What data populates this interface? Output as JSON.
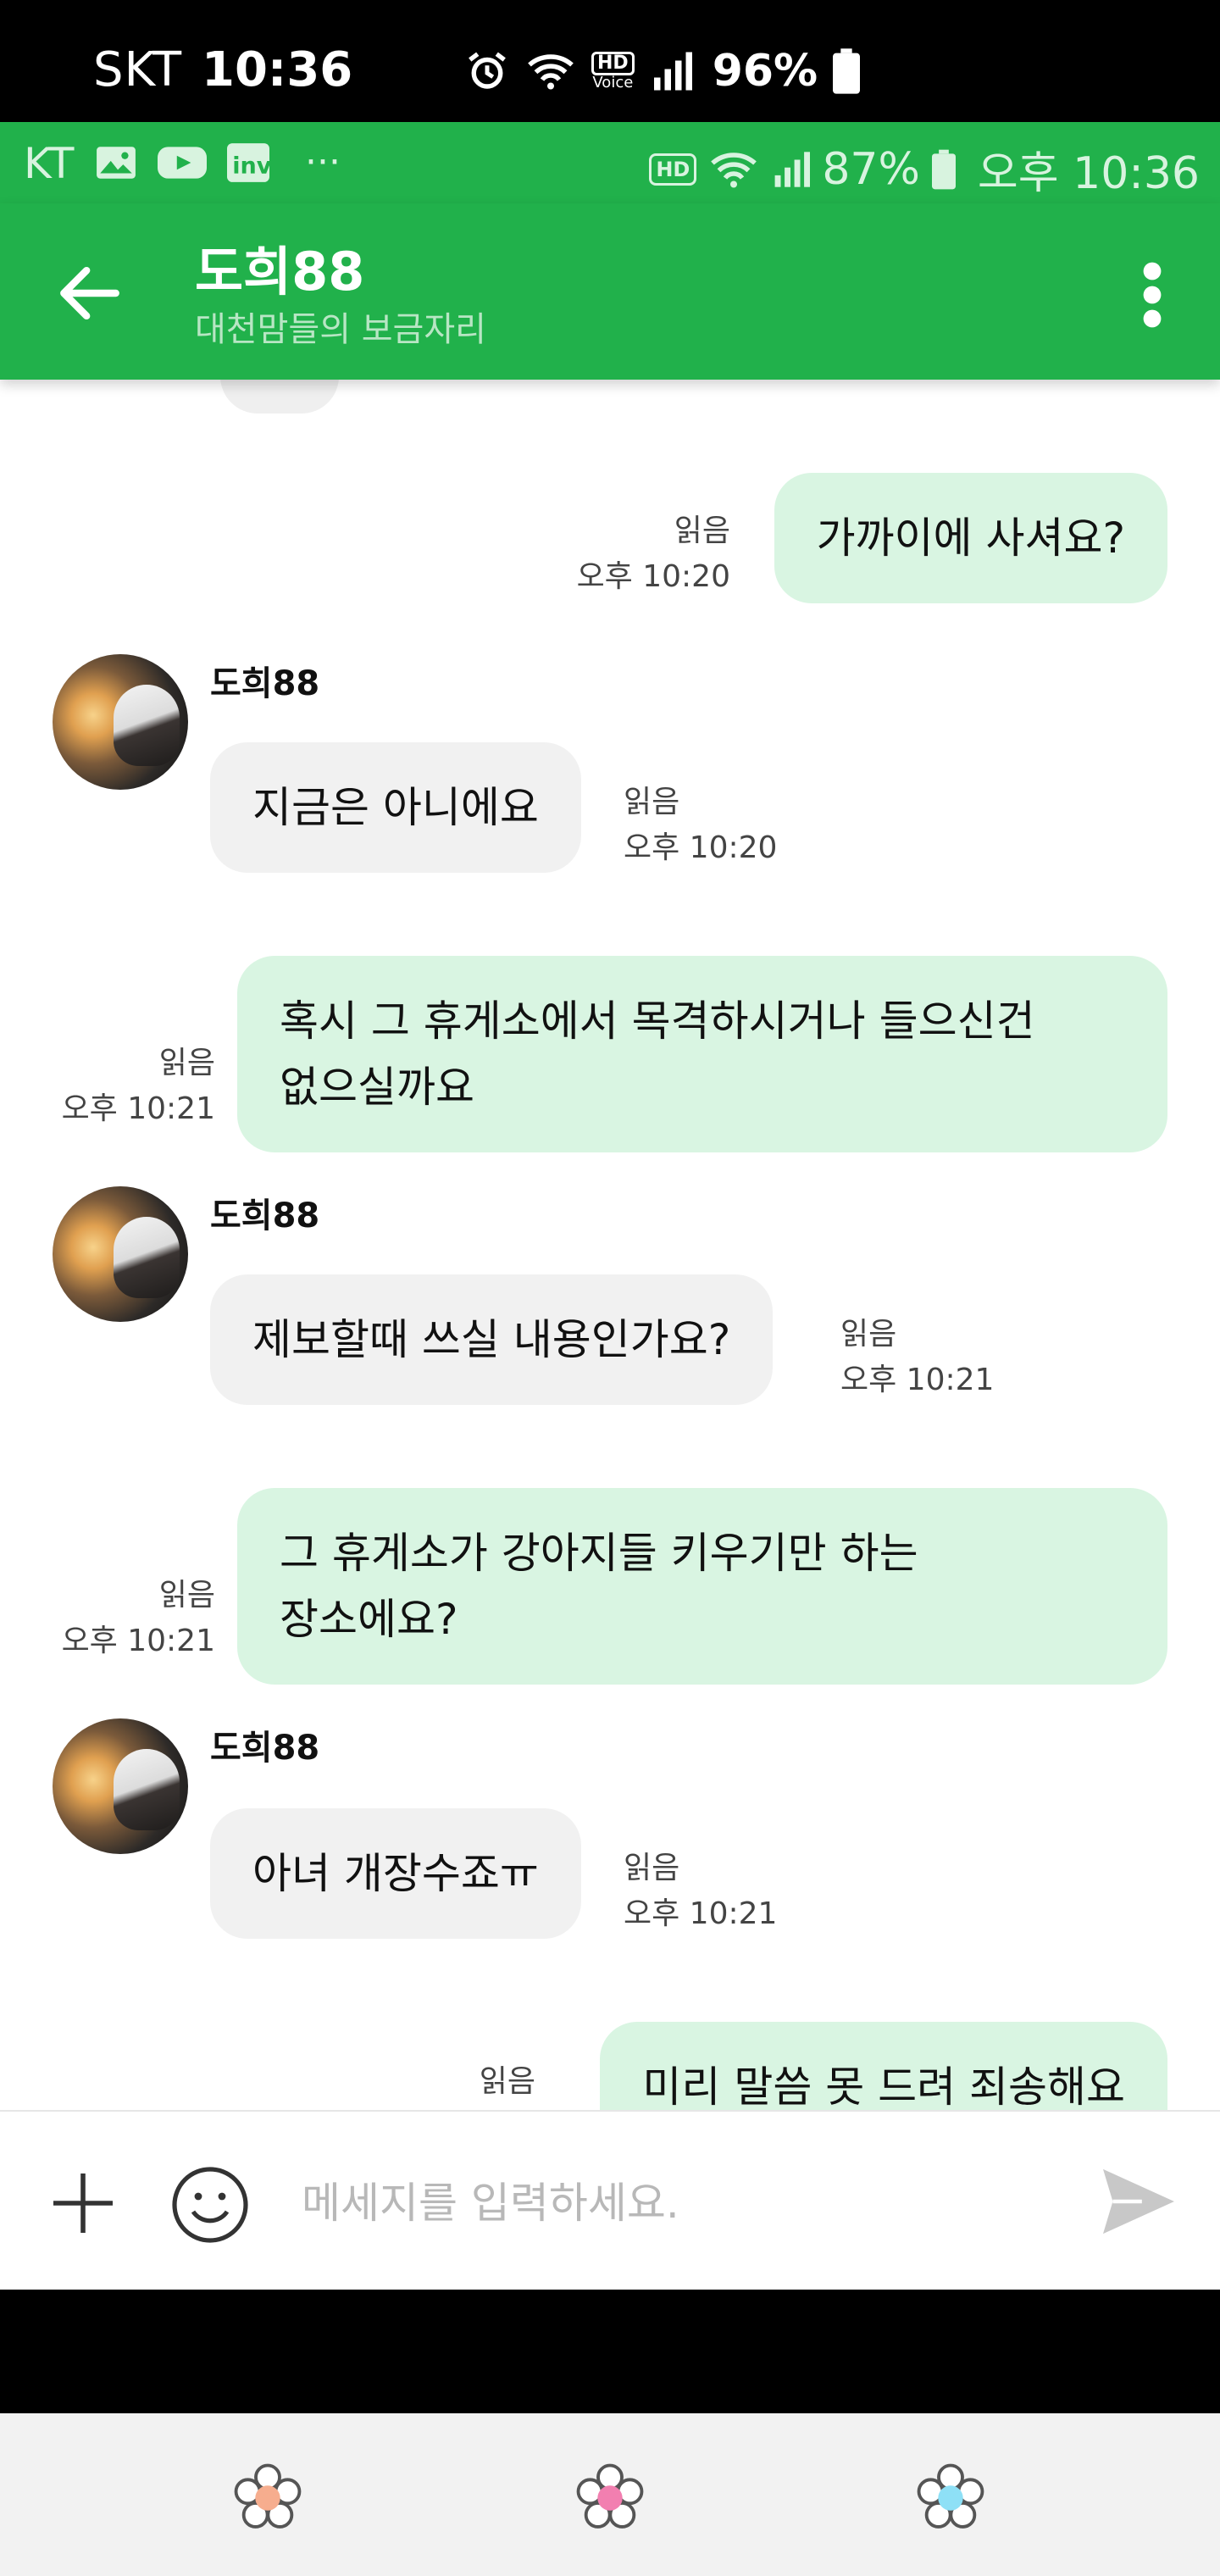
{
  "outer_status": {
    "carrier": "SKT",
    "time": "10:36",
    "hd_label": "HD",
    "voice_label": "Voice",
    "battery": "96%"
  },
  "inner_status": {
    "carrier": "KT",
    "more": "···",
    "hd_label": "HD",
    "battery": "87%",
    "time": "오후 10:36"
  },
  "app_bar": {
    "title": "도희88",
    "subtitle": "대천맘들의 보금자리"
  },
  "messages": [
    {
      "text": "가까이에 사셔요?",
      "read": "읽음",
      "time": "오후 10:20"
    },
    {
      "sender": "도희88",
      "text": "지금은 아니에요",
      "read": "읽음",
      "time": "오후 10:20"
    },
    {
      "line1": "혹시 그 휴게소에서 목격하시거나 들으신건",
      "line2": "없으실까요",
      "read": "읽음",
      "time": "오후 10:21"
    },
    {
      "sender": "도희88",
      "text": "제보할때 쓰실 내용인가요?",
      "read": "읽음",
      "time": "오후 10:21"
    },
    {
      "line1": "그 휴게소가 강아지들 키우기만 하는",
      "line2": "장소에요?",
      "read": "읽음",
      "time": "오후 10:21"
    },
    {
      "sender": "도희88",
      "text": "아녀 개장수죠ㅠ",
      "read": "읽음",
      "time": "오후 10:21"
    },
    {
      "text": "미리 말씀 못 드려 죄송해요",
      "read": "읽음"
    }
  ],
  "input": {
    "placeholder": "메세지를 입력하세요."
  },
  "colors": {
    "brand_green": "#21b14b",
    "outgoing_bubble": "#d9f5e2",
    "incoming_bubble": "#f1f1f1"
  },
  "bottom_nav": {
    "icons": [
      "flower-orange-icon",
      "flower-pink-icon",
      "flower-blue-icon"
    ]
  }
}
